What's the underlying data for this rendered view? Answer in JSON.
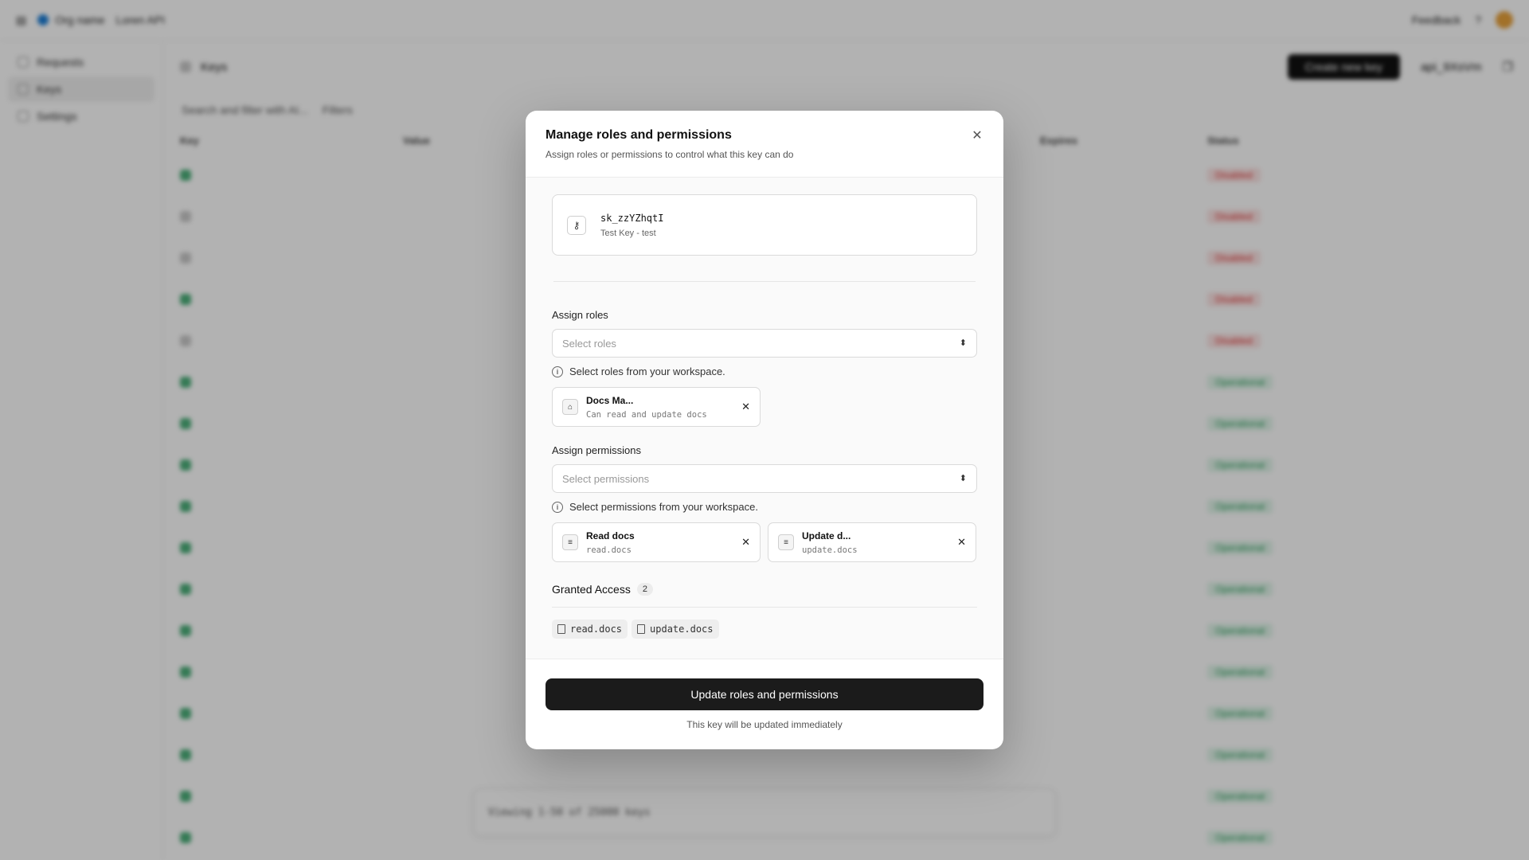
{
  "background": {
    "nav": {
      "workspace": "Org name",
      "api": "Loren API",
      "feedback": "Feedback"
    },
    "sidebar": [
      {
        "label": "Requests"
      },
      {
        "label": "Keys"
      },
      {
        "label": "Settings"
      }
    ],
    "header": {
      "title": "Keys",
      "create_label": "Create new key",
      "api_id": "api_9XsVm"
    },
    "filter": {
      "placeholder": "Search and filter with AI...",
      "filters_label": "Filters"
    },
    "columns": {
      "key": "Key",
      "value": "Value",
      "expires": "Expires",
      "status": "Status"
    },
    "pager": {
      "showing": "Viewing 1-50 of 25000 keys"
    },
    "rows": [
      {
        "status": "Disabled"
      },
      {
        "status": "Disabled"
      },
      {
        "status": "Disabled"
      },
      {
        "status": "Disabled"
      },
      {
        "status": "Disabled"
      },
      {
        "status": "Operational"
      },
      {
        "status": "Operational"
      },
      {
        "status": "Operational"
      },
      {
        "status": "Operational"
      },
      {
        "status": "Operational"
      },
      {
        "status": "Operational"
      },
      {
        "status": "Operational"
      },
      {
        "status": "Operational"
      },
      {
        "status": "Operational"
      },
      {
        "status": "Operational"
      },
      {
        "status": "Operational"
      },
      {
        "status": "Operational"
      }
    ]
  },
  "modal": {
    "title": "Manage roles and permissions",
    "subtitle": "Assign roles or permissions to control what this key can do",
    "close_icon": "x-icon",
    "key": {
      "id": "sk_zzYZhqtI",
      "name": "Test Key - test",
      "icon": "key-icon"
    },
    "roles": {
      "label": "Assign roles",
      "placeholder": "Select roles",
      "hint": "Select roles from your workspace.",
      "selected": [
        {
          "title": "Docs Ma...",
          "desc": "Can read and update docs",
          "icon": "tag-icon"
        }
      ]
    },
    "permissions": {
      "label": "Assign permissions",
      "placeholder": "Select permissions",
      "hint": "Select permissions from your workspace.",
      "selected": [
        {
          "title": "Read docs",
          "desc": "read.docs",
          "icon": "document-icon"
        },
        {
          "title": "Update d...",
          "desc": "update.docs",
          "icon": "document-icon"
        }
      ]
    },
    "granted": {
      "label": "Granted Access",
      "count": "2",
      "items": [
        "read.docs",
        "update.docs"
      ]
    },
    "submit_label": "Update roles and permissions",
    "footer_note": "This key will be updated immediately"
  }
}
